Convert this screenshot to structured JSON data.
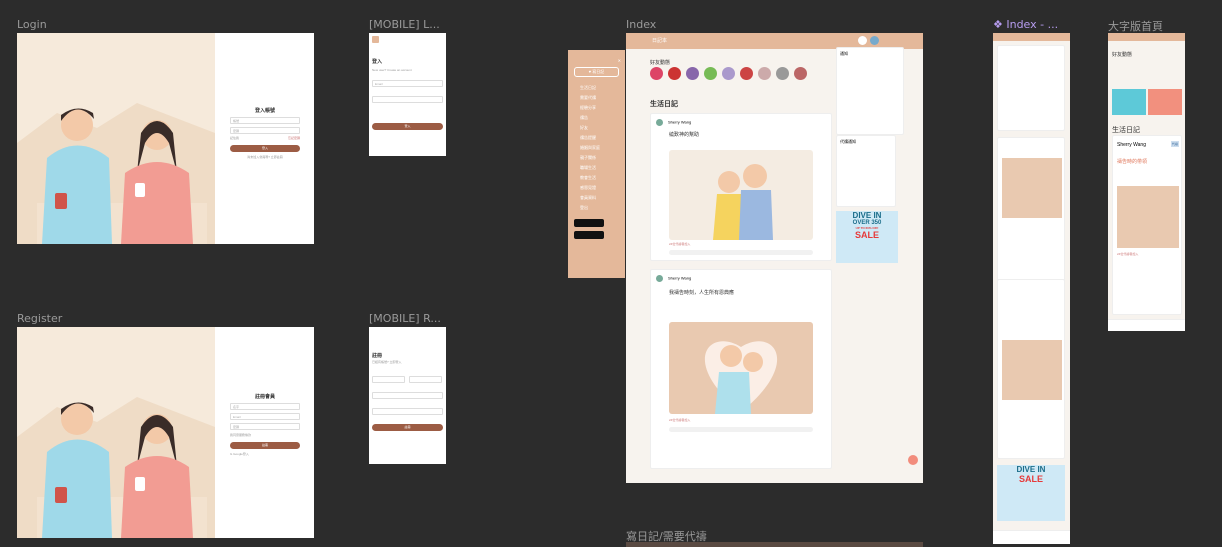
{
  "frames": {
    "login": "Login",
    "mobile_login": "[MOBILE] L...",
    "index": "Index",
    "index_component": "Index - ...",
    "large_font": "大字版首頁",
    "register": "Register",
    "mobile_register": "[MOBILE] R...",
    "bottom": "寫日記/需要代禱"
  },
  "login": {
    "title": "登入帳號",
    "email_ph": "帳號",
    "pwd_ph": "密碼",
    "remember": "記住我",
    "forgot": "忘記密碼",
    "submit": "登入",
    "signup_hint": "尚未加入會員嗎? 立即註冊"
  },
  "mobile_login": {
    "title": "登入",
    "hint": "New user? Create an account",
    "email": "Email",
    "submit": "登入"
  },
  "register": {
    "title": "註冊會員",
    "name_ph": "名字",
    "email_ph": "Email",
    "pwd_ph": "密碼",
    "agree": "我同意服務條款",
    "submit": "註冊",
    "google": "G Google登入"
  },
  "mobile_register": {
    "title": "註冊",
    "hint": "已經有帳號? 立即登入",
    "submit": "註冊"
  },
  "index": {
    "brand": "日記本",
    "sidebar": [
      "生活日記",
      "需要代禱",
      "經驗分享",
      "禱告",
      "好友",
      "禱告提醒",
      "婚姻與家庭",
      "親子關係",
      "職場生活",
      "教會生活",
      "感恩見證",
      "會員資料",
      "登出"
    ],
    "sidebar_btn": "寫日記",
    "friends_label": "好友動態",
    "section_title": "生活日記",
    "post1": {
      "author": "Sherry Wang",
      "title": "繞歎神的幫助",
      "likes": "24位代禱者加入"
    },
    "post2": {
      "author": "Sherry Wang",
      "title": "我禱告時刻，人生所有恩典應",
      "likes": "24位代禱者加入"
    },
    "notif_title": "通知",
    "prayer_title": "代禱通知",
    "ad": {
      "l1": "DIVE IN",
      "l2": "OVER 350",
      "l3": "MORE STYLES",
      "l4": "UP TO 60% OFF",
      "l5": "SALE"
    }
  },
  "large": {
    "friends": "好友動態",
    "diary": "生活日記",
    "user": "Sherry Wang",
    "tag": "代禱",
    "post_title": "禱告時的帶領",
    "likes": "24位代禱者加入"
  },
  "colors": {
    "bg": "#2c2c2c",
    "accent": "#9c5c44",
    "peach": "#e4b89a",
    "cream": "#f6eadb",
    "sale": "#e63a3a"
  }
}
